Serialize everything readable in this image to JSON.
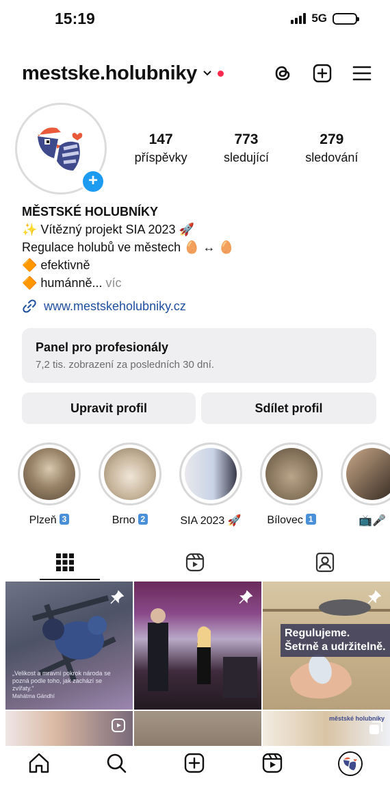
{
  "status": {
    "time": "15:19",
    "network": "5G"
  },
  "header": {
    "username": "mestske.holubniky"
  },
  "stats": [
    {
      "num": "147",
      "label": "příspěvky"
    },
    {
      "num": "773",
      "label": "sledující"
    },
    {
      "num": "279",
      "label": "sledování"
    }
  ],
  "bio": {
    "name": "MĚSTSKÉ HOLUBNÍKY",
    "line1": "✨ Vítězný projekt SIA 2023 🚀",
    "line2": "Regulace holubů ve městech 🥚 ↔ 🥚",
    "line3": "🔶 efektivně",
    "line4": "🔶 humánně...",
    "more": "víc",
    "link": "www.mestskeholubniky.cz"
  },
  "panel": {
    "title": "Panel pro profesionály",
    "subtitle": "7,2 tis. zobrazení za posledních 30 dní."
  },
  "buttons": {
    "edit": "Upravit profil",
    "share": "Sdílet profil"
  },
  "highlights": [
    {
      "label": "Plzeň",
      "badge": "3"
    },
    {
      "label": "Brno",
      "badge": "2"
    },
    {
      "label": "SIA 2023 🚀",
      "badge": ""
    },
    {
      "label": "Bílovec",
      "badge": "1"
    },
    {
      "label": "📺🎤",
      "badge": ""
    }
  ],
  "posts": {
    "post1_quote": "„Velikost a mravní pokrok národa se pozná podle toho, jak zachází se zvířaty.“",
    "post1_author": "Mahátma Gándhí",
    "post3_banner_line1": "Regulujeme.",
    "post3_banner_line2": "Šetrně a udržitelně.",
    "post6_caption": "městské holubníky"
  },
  "colors": {
    "accent": "#1d9bf0",
    "link": "#1f4fa0",
    "notify": "#ff2a4d"
  }
}
